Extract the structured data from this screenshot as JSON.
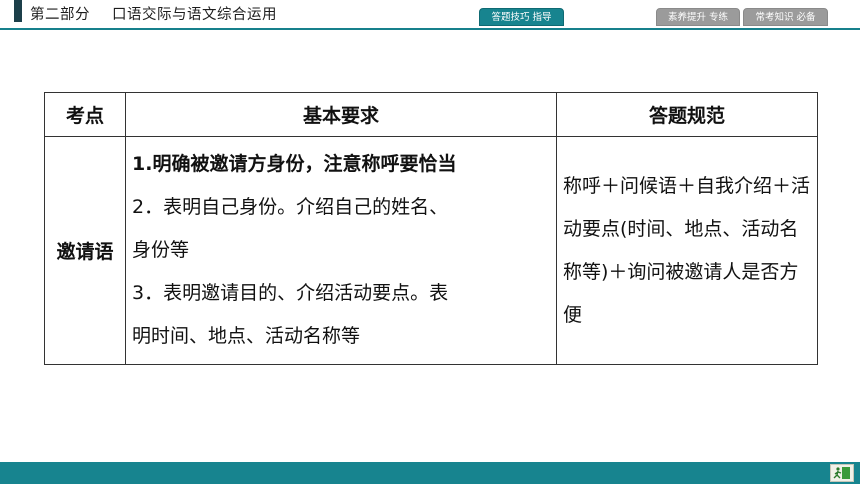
{
  "header": {
    "part": "第二部分",
    "section": "口语交际与语文综合运用"
  },
  "tabs": [
    {
      "label": "答题技巧  指导",
      "active": true
    },
    {
      "label": "素养提升  专练",
      "active": false
    },
    {
      "label": "常考知识  必备",
      "active": false
    }
  ],
  "table": {
    "headers": [
      "考点",
      "基本要求",
      "答题规范"
    ],
    "rows": [
      {
        "topic": "邀请语",
        "requirements": [
          "1.明确被邀请方身份，注意称呼要恰当",
          "2．表明自己身份。介绍自己的姓名、",
          "身份等",
          "3．表明邀请目的、介绍活动要点。表",
          "明时间、地点、活动名称等"
        ],
        "specification": "称呼＋问候语＋自我介绍＋活动要点(时间、地点、活动名称等)＋询问被邀请人是否方便"
      }
    ]
  },
  "colors": {
    "accent": "#17848f",
    "tab_inactive": "#9b9b9b",
    "header_block": "#1c3f4a"
  },
  "footer": {
    "icon": "exit-door-icon"
  }
}
